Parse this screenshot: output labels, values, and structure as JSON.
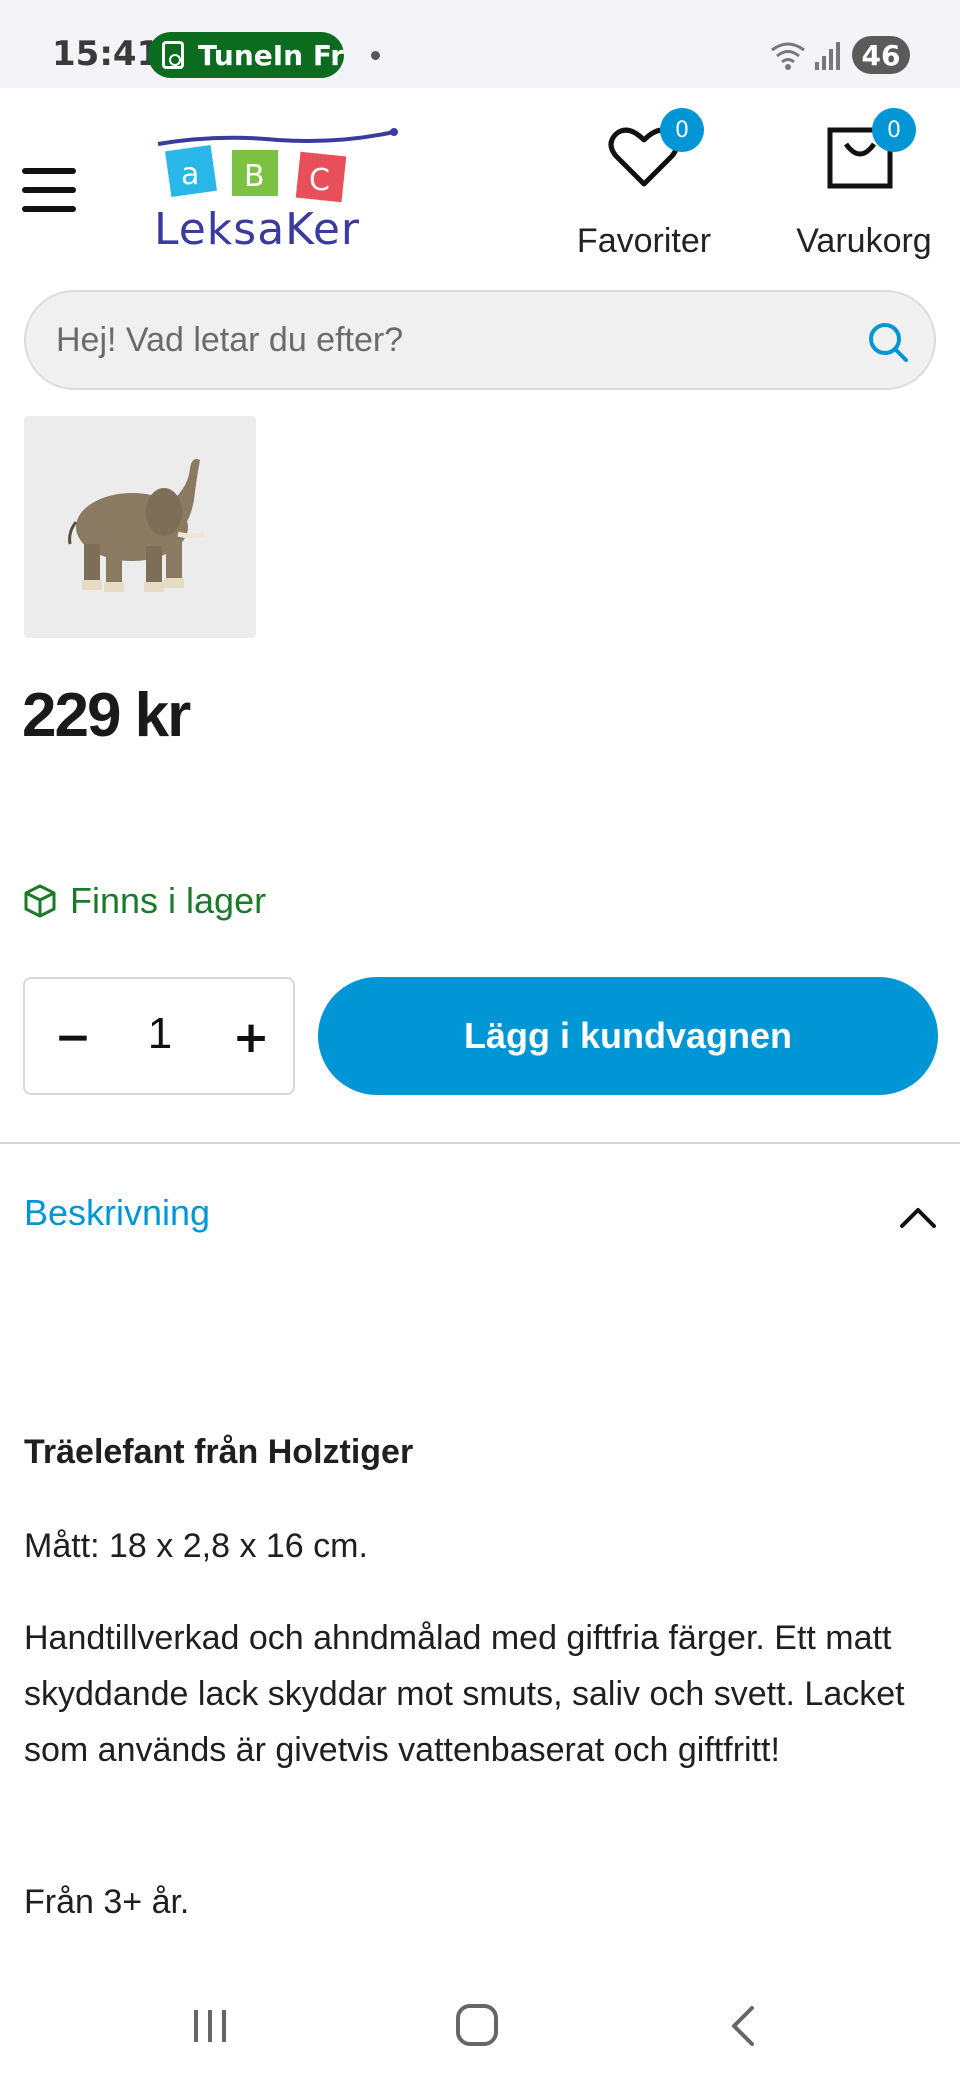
{
  "status_bar": {
    "time": "15:41",
    "media_app": "TuneIn Fr",
    "battery": "46"
  },
  "header": {
    "logo_text": "LEKSAKER",
    "favorites_label": "Favoriter",
    "favorites_count": "0",
    "cart_label": "Varukorg",
    "cart_count": "0"
  },
  "search": {
    "placeholder": "Hej! Vad letar du efter?"
  },
  "product": {
    "price": "229 kr",
    "stock_status": "Finns i lager",
    "quantity": "1",
    "minus_label": "−",
    "plus_label": "+",
    "add_to_cart_label": "Lägg i kundvagnen"
  },
  "description": {
    "heading": "Beskrivning",
    "title": "Träelefant från Holztiger",
    "dimensions": "Mått: 18 x 2,8 x 16 cm.",
    "body": "Handtillverkad och ahndmålad med giftfria färger. Ett matt skyddande lack skyddar mot smuts, saliv och svett. Lacket som används är givetvis vattenbaserat och giftfritt!",
    "age": "Från 3+ år."
  },
  "colors": {
    "accent": "#0096d6",
    "stock_green": "#1a7a2a",
    "status_pill": "#0b6b1e"
  }
}
